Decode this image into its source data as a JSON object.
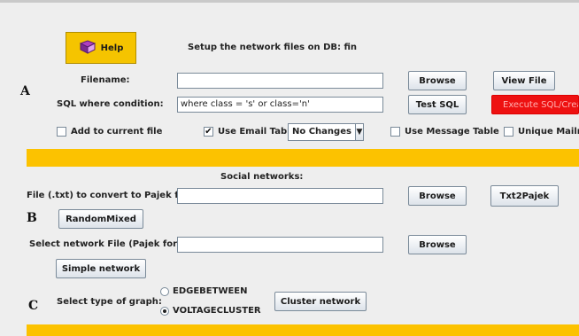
{
  "sections": {
    "a": "A",
    "b": "B",
    "c": "C"
  },
  "help": {
    "label": "Help"
  },
  "setup_text": "Setup the network files on DB: fin",
  "filename": {
    "label": "Filename:",
    "value": ""
  },
  "sql": {
    "label": "SQL where condition:",
    "value": "where class = 's' or class='n'"
  },
  "buttons": {
    "browse1": "Browse",
    "view_file": "View File",
    "test_sql": "Test SQL",
    "execute": "Execute SQL/Creat",
    "browse2": "Browse",
    "txt2pajek": "Txt2Pajek",
    "random_mixed": "RandomMixed",
    "browse3": "Browse",
    "simple_network": "Simple network",
    "cluster_network": "Cluster network"
  },
  "checkboxes": {
    "add_current": {
      "label": "Add to current file",
      "checked": false
    },
    "use_email": {
      "label": "Use Email Table",
      "checked": true
    },
    "use_message": {
      "label": "Use Message Table",
      "checked": false
    },
    "unique_mailref": {
      "label": "Unique Mailref",
      "checked": false
    }
  },
  "changes_select": {
    "value": "No Changes"
  },
  "social_title": "Social networks:",
  "txt_file": {
    "label": "File (.txt) to convert to Pajek format:",
    "value": ""
  },
  "net_file": {
    "label": "Select network File (Pajek format):",
    "value": ""
  },
  "graph": {
    "label": "Select type of graph:",
    "options": [
      {
        "label": "EDGEBETWEEN",
        "selected": false
      },
      {
        "label": "VOLTAGECLUSTER",
        "selected": true
      }
    ]
  },
  "colors": {
    "accent_yellow": "#fcc200",
    "execute_red": "#ee1111"
  }
}
